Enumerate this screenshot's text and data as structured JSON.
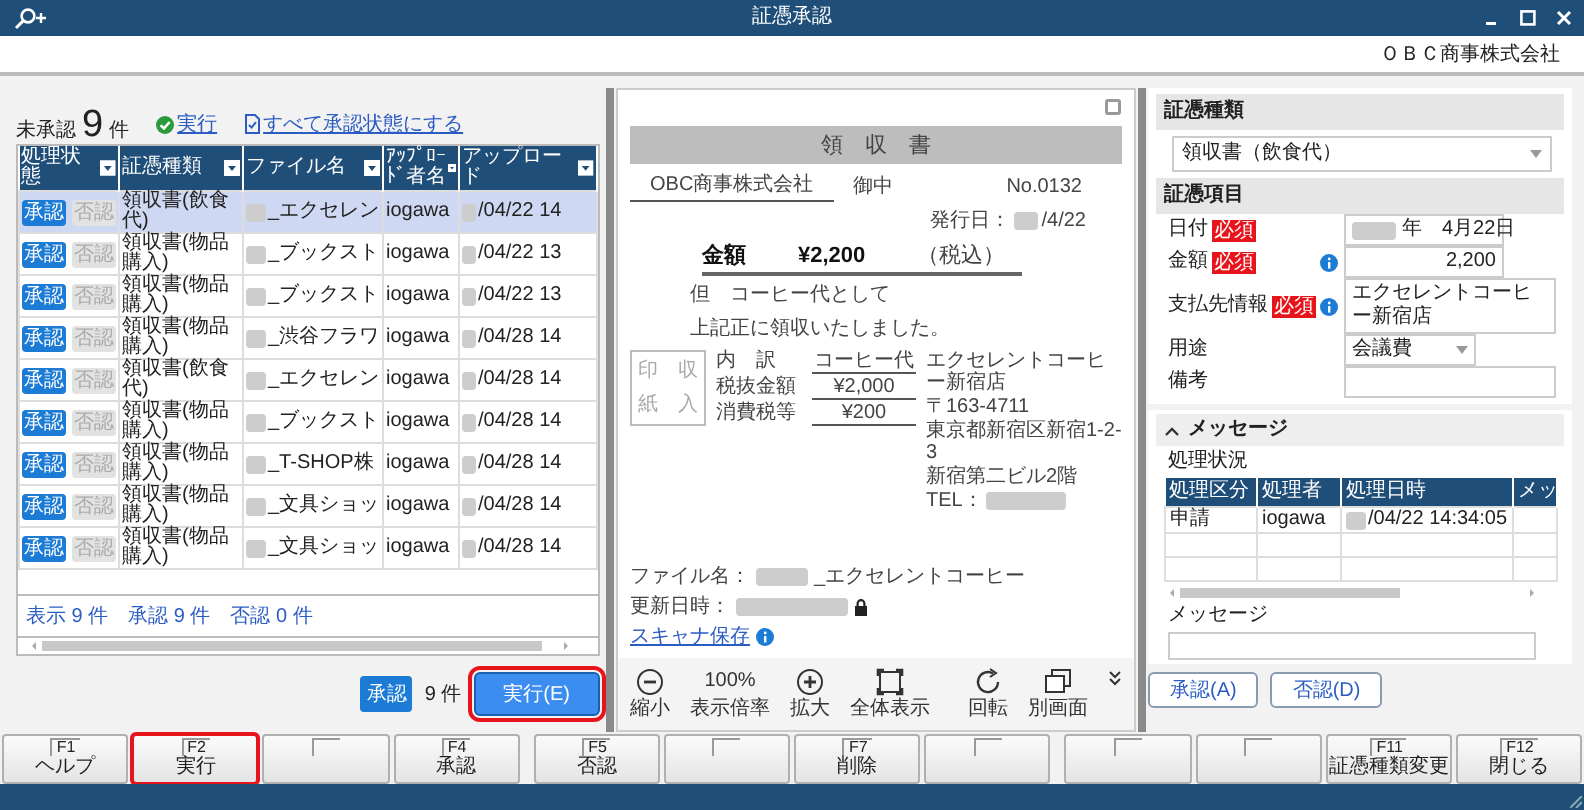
{
  "window": {
    "title": "証憑承認",
    "company": "ＯＢＣ商事株式会社"
  },
  "list": {
    "heading": "未承認",
    "count": "9",
    "count_unit": "件",
    "run_link": "実行",
    "approve_all_link": "すべて承認状態にする",
    "columns": [
      "処理状態",
      "証憑種類",
      "ファイル名",
      "ｱｯﾌﾟﾛｰﾄﾞ者名",
      "アップロード"
    ],
    "rows": [
      {
        "approved": true,
        "approve_label": "承認",
        "reject_label": "否認",
        "type": "領収書(飲食代)",
        "file": "_エクセレン",
        "user": "iogawa",
        "date": "/04/22 14",
        "selected": true
      },
      {
        "approved": true,
        "approve_label": "承認",
        "reject_label": "否認",
        "type": "領収書(物品購入)",
        "file": "_ブックスト",
        "user": "iogawa",
        "date": "/04/22 13",
        "selected": false
      },
      {
        "approved": true,
        "approve_label": "承認",
        "reject_label": "否認",
        "type": "領収書(物品購入)",
        "file": "_ブックスト",
        "user": "iogawa",
        "date": "/04/22 13",
        "selected": false
      },
      {
        "approved": true,
        "approve_label": "承認",
        "reject_label": "否認",
        "type": "領収書(物品購入)",
        "file": "_渋谷フラワ",
        "user": "iogawa",
        "date": "/04/28 14",
        "selected": false
      },
      {
        "approved": true,
        "approve_label": "承認",
        "reject_label": "否認",
        "type": "領収書(飲食代)",
        "file": "_エクセレン",
        "user": "iogawa",
        "date": "/04/28 14",
        "selected": false
      },
      {
        "approved": true,
        "approve_label": "承認",
        "reject_label": "否認",
        "type": "領収書(物品購入)",
        "file": "_ブックスト",
        "user": "iogawa",
        "date": "/04/28 14",
        "selected": false
      },
      {
        "approved": true,
        "approve_label": "承認",
        "reject_label": "否認",
        "type": "領収書(物品購入)",
        "file": "_T-SHOP株",
        "user": "iogawa",
        "date": "/04/28 14",
        "selected": false
      },
      {
        "approved": true,
        "approve_label": "承認",
        "reject_label": "否認",
        "type": "領収書(物品購入)",
        "file": "_文具ショッ",
        "user": "iogawa",
        "date": "/04/28 14",
        "selected": false
      },
      {
        "approved": true,
        "approve_label": "承認",
        "reject_label": "否認",
        "type": "領収書(物品購入)",
        "file": "_文具ショッ",
        "user": "iogawa",
        "date": "/04/28 14",
        "selected": false
      }
    ],
    "summary": "表示 9 件　承認 9 件　否認 0 件",
    "footer": {
      "badge": "承認",
      "count": "9 件",
      "button": {
        "label": "実行(E)",
        "highlighted": true
      }
    }
  },
  "preview": {
    "title": "領　収　書",
    "addressee": "OBC商事株式会社",
    "honorific": "御中",
    "number": "No.0132",
    "issue_label": "発行日：",
    "issue_date": "/4/22",
    "amount_label": "金額",
    "amount": "¥2,200",
    "tax_note": "（税込）",
    "purpose": "但　コーヒー代として",
    "received": "上記正に領収いたしました。",
    "stamp": [
      "印　収",
      "紙　入"
    ],
    "breakdown": [
      {
        "label": "内　訳",
        "value": "コーヒー代"
      },
      {
        "label": "税抜金額",
        "value": "¥2,000"
      },
      {
        "label": "消費税等",
        "value": "¥200"
      }
    ],
    "issuer": [
      "エクセレントコーヒー新宿店",
      "〒163-4711",
      "東京都新宿区新宿1-2-3",
      "新宿第二ビル2階"
    ],
    "tel_label": "TEL：",
    "file_label": "ファイル名：",
    "file_name": "_エクセレントコーヒー",
    "updated_label": "更新日時：",
    "scan_link": "スキャナ保存",
    "zoom": "100%",
    "tools": [
      {
        "kind": "minus",
        "label": "縮小"
      },
      {
        "kind": "level",
        "label": "表示倍率"
      },
      {
        "kind": "plus",
        "label": "拡大"
      },
      {
        "kind": "fit",
        "label": "全体表示"
      },
      {
        "kind": "rotate",
        "label": "回転"
      },
      {
        "kind": "window",
        "label": "別画面"
      }
    ]
  },
  "detail": {
    "type_section": "証憑種類",
    "type_value": "領収書（飲食代）",
    "items_section": "証憑項目",
    "fields": [
      {
        "label": "日付",
        "badge": "必須",
        "info": false,
        "kind": "date",
        "value": "年　4月22日"
      },
      {
        "label": "金額",
        "badge": "必須",
        "info": true,
        "kind": "number",
        "value": "2,200"
      },
      {
        "label": "支払先情報",
        "badge": "必須",
        "info": true,
        "kind": "text",
        "value": "エクセレントコーヒー新宿店"
      },
      {
        "label": "用途",
        "info": false,
        "kind": "select",
        "value": "会議費"
      },
      {
        "label": "備考",
        "info": false,
        "kind": "text"
      }
    ],
    "message": {
      "title": "メッセージ",
      "expanded": true,
      "status_label": "処理状況",
      "columns": [
        "処理区分",
        "処理者",
        "処理日時",
        "メッ"
      ],
      "rows": [
        {
          "category": "申請",
          "user": "iogawa",
          "datetime": "/04/22 14:34:05"
        }
      ],
      "message_label": "メッセージ"
    },
    "buttons": [
      "承認(A)",
      "否認(D)"
    ]
  },
  "fkeys": [
    {
      "kind": "key",
      "key": "F1",
      "label": "ヘルプ",
      "highlighted": false
    },
    {
      "kind": "key",
      "key": "F2",
      "label": "実行",
      "highlighted": true
    },
    {
      "kind": "empty"
    },
    {
      "kind": "key",
      "key": "F4",
      "label": "承認",
      "highlighted": false
    },
    {
      "kind": "key",
      "key": "F5",
      "label": "否認",
      "highlighted": false
    },
    {
      "kind": "empty"
    },
    {
      "kind": "key",
      "key": "F7",
      "label": "削除",
      "highlighted": false
    },
    {
      "kind": "empty"
    },
    {
      "kind": "empty"
    },
    {
      "kind": "empty"
    },
    {
      "kind": "key",
      "key": "F11",
      "label": "証憑種類変更",
      "highlighted": false
    },
    {
      "kind": "key",
      "key": "F12",
      "label": "閉じる",
      "highlighted": false
    }
  ]
}
